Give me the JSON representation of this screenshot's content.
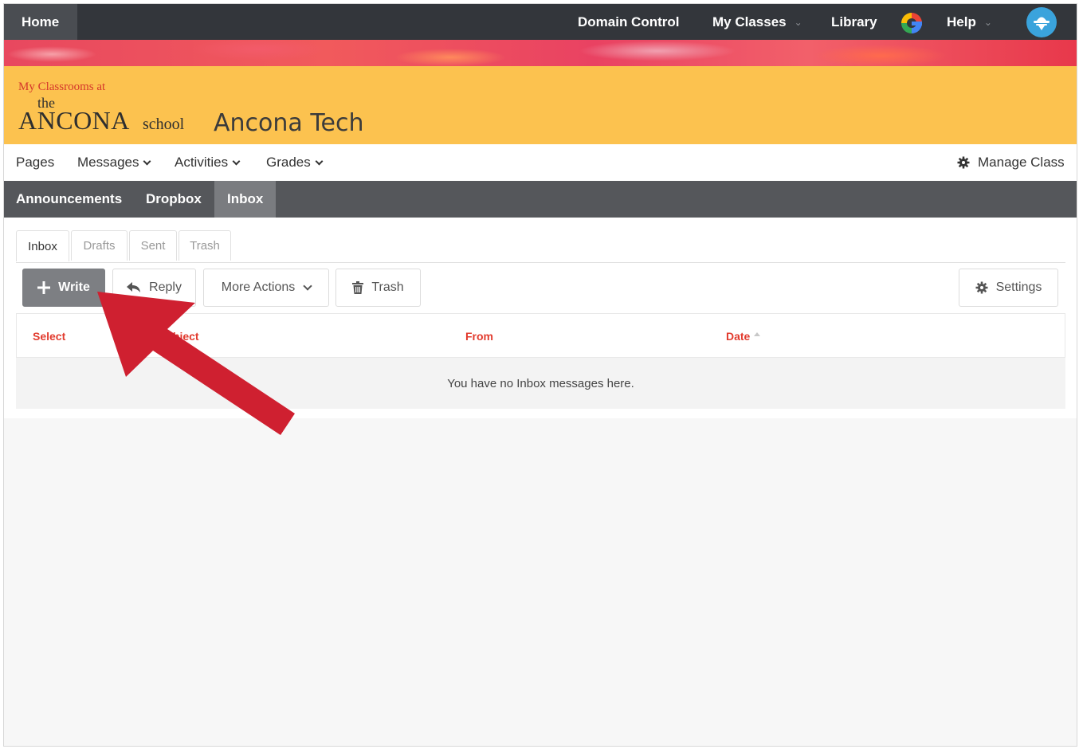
{
  "topbar": {
    "home": "Home",
    "domain_control": "Domain Control",
    "my_classes": "My Classes",
    "library": "Library",
    "help": "Help",
    "icons": {
      "google": "google-icon",
      "avatar": "user-avatar"
    }
  },
  "class_header": {
    "logo_line1": "My Classrooms at",
    "logo_the": "the",
    "logo_ancona": "ANCONA",
    "logo_school": "school",
    "title": "Ancona Tech"
  },
  "class_nav": {
    "pages": "Pages",
    "messages": "Messages",
    "activities": "Activities",
    "grades": "Grades",
    "manage_class": "Manage Class"
  },
  "sub_nav": {
    "announcements": "Announcements",
    "dropbox": "Dropbox",
    "inbox": "Inbox"
  },
  "message_tabs": [
    "Inbox",
    "Drafts",
    "Sent",
    "Trash"
  ],
  "toolbar": {
    "write": "Write",
    "reply": "Reply",
    "more_actions": "More Actions",
    "trash": "Trash",
    "settings": "Settings"
  },
  "table": {
    "columns": {
      "select": "Select",
      "subject": "Subject",
      "from": "From",
      "date": "Date"
    },
    "empty_message": "You have no Inbox messages here."
  },
  "colors": {
    "topbar": "#33363b",
    "header_yellow": "#fcc24f",
    "subnav": "#55575b",
    "column_header_red": "#e23b2e",
    "arrow_red": "#cf2030"
  }
}
